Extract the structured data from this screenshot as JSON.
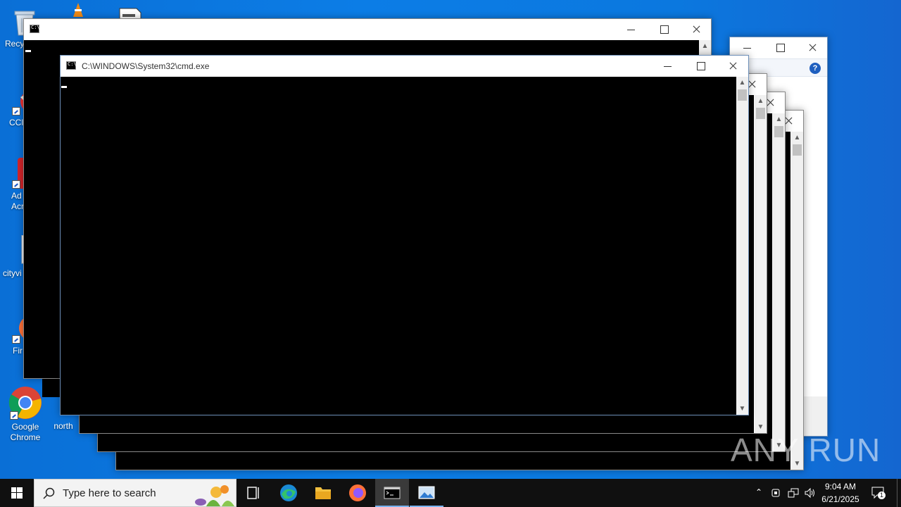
{
  "desktop_icons": [
    {
      "id": "recycle-bin",
      "label": "Recy"
    },
    {
      "id": "ccleaner",
      "label": "CCl"
    },
    {
      "id": "acrobat",
      "label": "Ad\nAcr"
    },
    {
      "id": "cityview",
      "label": "cityvi"
    },
    {
      "id": "firefox",
      "label": "Fir"
    },
    {
      "id": "chrome",
      "label": "Google\nChrome"
    },
    {
      "id": "north",
      "label": "north"
    }
  ],
  "windows": {
    "cmd_front": {
      "title": "C:\\WINDOWS\\System32\\cmd.exe"
    },
    "cmd_back": {
      "title": ""
    }
  },
  "taskbar": {
    "search_placeholder": "Type here to search",
    "clock_time": "9:04 AM",
    "clock_date": "6/21/2025",
    "notification_count": "1"
  },
  "watermark": "ANY RUN",
  "colors": {
    "desktop": "#0b78df",
    "taskbar": "#101010",
    "console": "#000000"
  }
}
